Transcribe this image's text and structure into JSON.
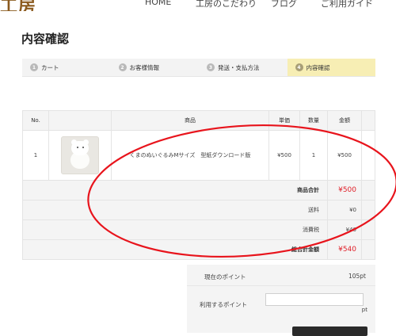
{
  "header": {
    "logo_text": "工房",
    "nav": [
      {
        "label": "HOME"
      },
      {
        "label": "工房のこだわり"
      },
      {
        "label": "ブログ"
      },
      {
        "label": "ご利用ガイド"
      }
    ]
  },
  "page_title": "内容確認",
  "steps": [
    {
      "num": "1",
      "label": "カート"
    },
    {
      "num": "2",
      "label": "お客様情報"
    },
    {
      "num": "3",
      "label": "発送・支払方法"
    },
    {
      "num": "4",
      "label": "内容確認",
      "active": true
    }
  ],
  "table": {
    "headers": {
      "no": "No.",
      "product": "商品",
      "price": "単価",
      "qty": "数量",
      "amount": "金額"
    },
    "rows": [
      {
        "no": "1",
        "name": "くまのぬいぐるみMサイズ　型紙ダウンロード版",
        "price": "¥500",
        "qty": "1",
        "amount": "¥500",
        "thumb_icon": "teddy-bear-photo"
      }
    ]
  },
  "summary": {
    "subtotal_label": "商品合計",
    "subtotal_value": "¥500",
    "shipping_label": "送料",
    "shipping_value": "¥0",
    "tax_label": "消費税",
    "tax_value": "¥40",
    "total_label": "総合計金額",
    "total_value": "¥540"
  },
  "points": {
    "current_label": "現在のポイント",
    "current_value": "105pt",
    "use_label": "利用するポイント",
    "use_value": "",
    "unit": "pt"
  },
  "colors": {
    "accent_red": "#e0202a",
    "annotation_red": "#e8141c",
    "active_step_bg": "#f7eeb4",
    "logo_brown": "#8b5a1e"
  }
}
